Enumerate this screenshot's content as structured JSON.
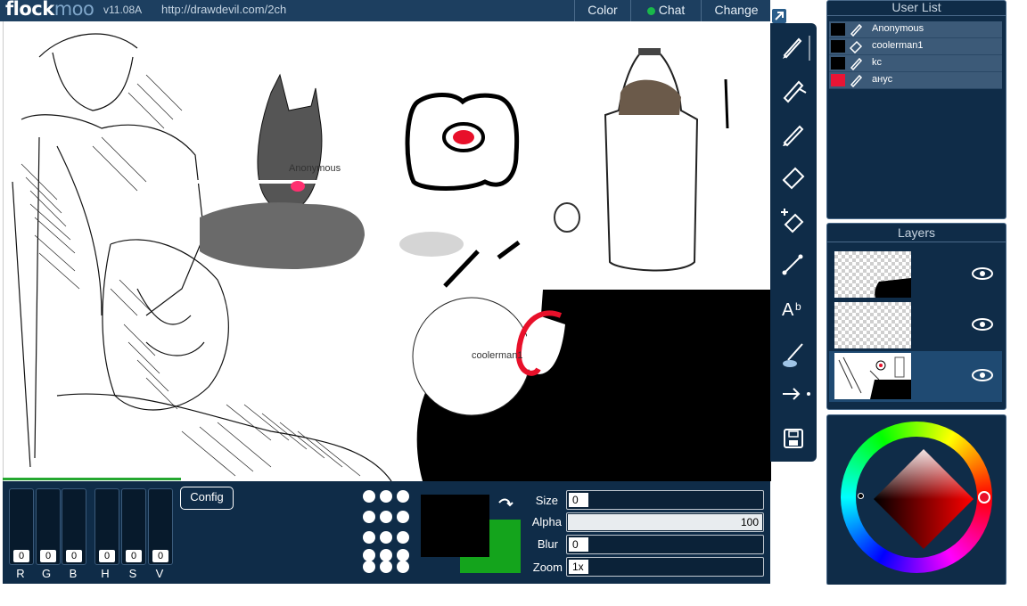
{
  "header": {
    "logo_text_a": "flock",
    "logo_text_b": "moo",
    "version": "v11.08A",
    "url": "http://drawdevil.com/2ch",
    "tabs": [
      {
        "label": "Color"
      },
      {
        "label": "Chat"
      },
      {
        "label": "Change"
      }
    ]
  },
  "canvas": {
    "cursor_labels": [
      "Anonymous",
      "coolerman1"
    ]
  },
  "toolbar": {
    "tools": [
      "brush-icon",
      "smudge-brush-icon",
      "pencil-icon",
      "eraser-icon",
      "magic-eraser-icon",
      "line-icon",
      "text-icon",
      "fill-icon",
      "arrow-icon",
      "save-icon"
    ]
  },
  "color_sliders": [
    {
      "label": "R",
      "value": "0"
    },
    {
      "label": "G",
      "value": "0"
    },
    {
      "label": "B",
      "value": "0"
    },
    {
      "label": "H",
      "value": "0"
    },
    {
      "label": "S",
      "value": "0"
    },
    {
      "label": "V",
      "value": "0"
    }
  ],
  "config_label": "Config",
  "brush_settings": {
    "size_label": "Size",
    "size_value": "0",
    "alpha_label": "Alpha",
    "alpha_value": "100",
    "blur_label": "Blur",
    "blur_value": "0",
    "zoom_label": "Zoom",
    "zoom_value": "1x"
  },
  "colors": {
    "foreground": "#000000",
    "background": "#14a41c",
    "accent": "#0f2c48"
  },
  "user_list": {
    "title": "User List",
    "users": [
      {
        "name": "Anonymous",
        "color": "#000000",
        "tool": "brush-icon"
      },
      {
        "name": "coolerman1",
        "color": "#000000",
        "tool": "eraser-icon"
      },
      {
        "name": "kc",
        "color": "#000000",
        "tool": "brush-icon"
      },
      {
        "name": "анус",
        "color": "#e81535",
        "tool": "brush-icon"
      }
    ]
  },
  "layers": {
    "title": "Layers",
    "count": 3,
    "selected": 3
  }
}
